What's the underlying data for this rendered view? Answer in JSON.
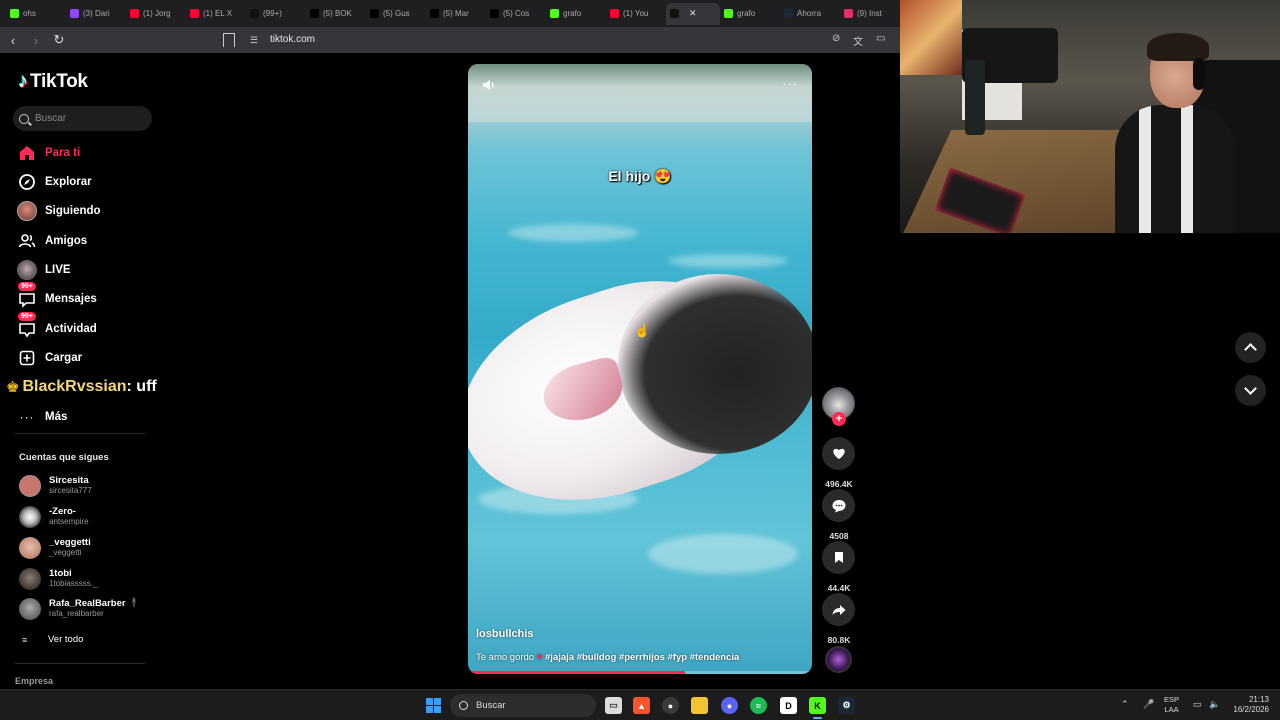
{
  "browser": {
    "tabs": [
      {
        "icon": "kick-icon",
        "color": "#53fc18",
        "label": "ohs"
      },
      {
        "icon": "twitch-icon",
        "color": "#9146ff",
        "label": "(3) Dari"
      },
      {
        "icon": "youtube-icon",
        "color": "#ff0033",
        "label": "(1) Jorg"
      },
      {
        "icon": "youtube-icon",
        "color": "#ff0033",
        "label": "(1) EL X"
      },
      {
        "icon": "tiktok-icon",
        "color": "#111111",
        "label": "(99+)"
      },
      {
        "icon": "x-icon",
        "color": "#000000",
        "label": "(5) BOK"
      },
      {
        "icon": "x-icon",
        "color": "#000000",
        "label": "(5) Gus"
      },
      {
        "icon": "x-icon",
        "color": "#000000",
        "label": "(5) Mar"
      },
      {
        "icon": "x-icon",
        "color": "#000000",
        "label": "(5) Cos"
      },
      {
        "icon": "kick-icon",
        "color": "#53fc18",
        "label": "grafo"
      },
      {
        "icon": "youtube-icon",
        "color": "#ff0033",
        "label": "(1) You"
      },
      {
        "icon": "tiktok-icon",
        "color": "#111111",
        "label": "",
        "active": true
      },
      {
        "icon": "kick-icon",
        "color": "#53fc18",
        "label": "grafo"
      },
      {
        "icon": "steam-icon",
        "color": "#1b2838",
        "label": "Ahorra"
      },
      {
        "icon": "instagram-icon",
        "color": "#e1306c",
        "label": "(9) Inst"
      }
    ],
    "url": "tiktok.com"
  },
  "sidebar": {
    "logo": "TikTok",
    "search_placeholder": "Buscar",
    "nav": [
      {
        "label": "Para ti",
        "icon": "home-icon",
        "active": true
      },
      {
        "label": "Explorar",
        "icon": "compass-icon"
      },
      {
        "label": "Siguiendo",
        "icon": "avatar"
      },
      {
        "label": "Amigos",
        "icon": "friends-icon"
      },
      {
        "label": "LIVE",
        "icon": "live-avatar"
      },
      {
        "label": "Mensajes",
        "icon": "messages-icon",
        "badge": "99+"
      },
      {
        "label": "Actividad",
        "icon": "activity-icon",
        "badge": "99+"
      },
      {
        "label": "Cargar",
        "icon": "upload-icon"
      },
      {
        "label": "Más",
        "icon": "more-icon"
      }
    ],
    "following_title": "Cuentas que sigues",
    "accounts": [
      {
        "name": "Sircesita",
        "username": "sircesita777",
        "color": "#c8756b"
      },
      {
        "name": "-Zero-",
        "username": "antsempire",
        "color": "#e6e6e6"
      },
      {
        "name": "_veggetti",
        "username": "_veggetti",
        "color": "#d9a38c"
      },
      {
        "name": "1tobi",
        "username": "1tobiasssss._",
        "color": "#4a4a4a"
      },
      {
        "name": "Rafa_RealBarber 🕴",
        "username": "rafa_realbarber",
        "color": "#777777"
      }
    ],
    "see_all": "Ver todo",
    "company": "Empresa"
  },
  "overlay_chat": {
    "user": "BlackRvssian",
    "message": "uff"
  },
  "video": {
    "caption_top": "El hijo 😍",
    "author": "losbullchis",
    "description_text": "Te amo gordo",
    "description_tags": "#jajaja #bulldog #perrhijos #fyp #tendencia",
    "progress": 0.63
  },
  "actions": {
    "likes": "496.4K",
    "comments": "4508",
    "saves": "44.4K",
    "shares": "80.8K"
  },
  "taskbar": {
    "search_placeholder": "Buscar",
    "lang_top": "ESP",
    "lang_bottom": "LAA",
    "time": "21:13",
    "date": "16/2/2026"
  }
}
